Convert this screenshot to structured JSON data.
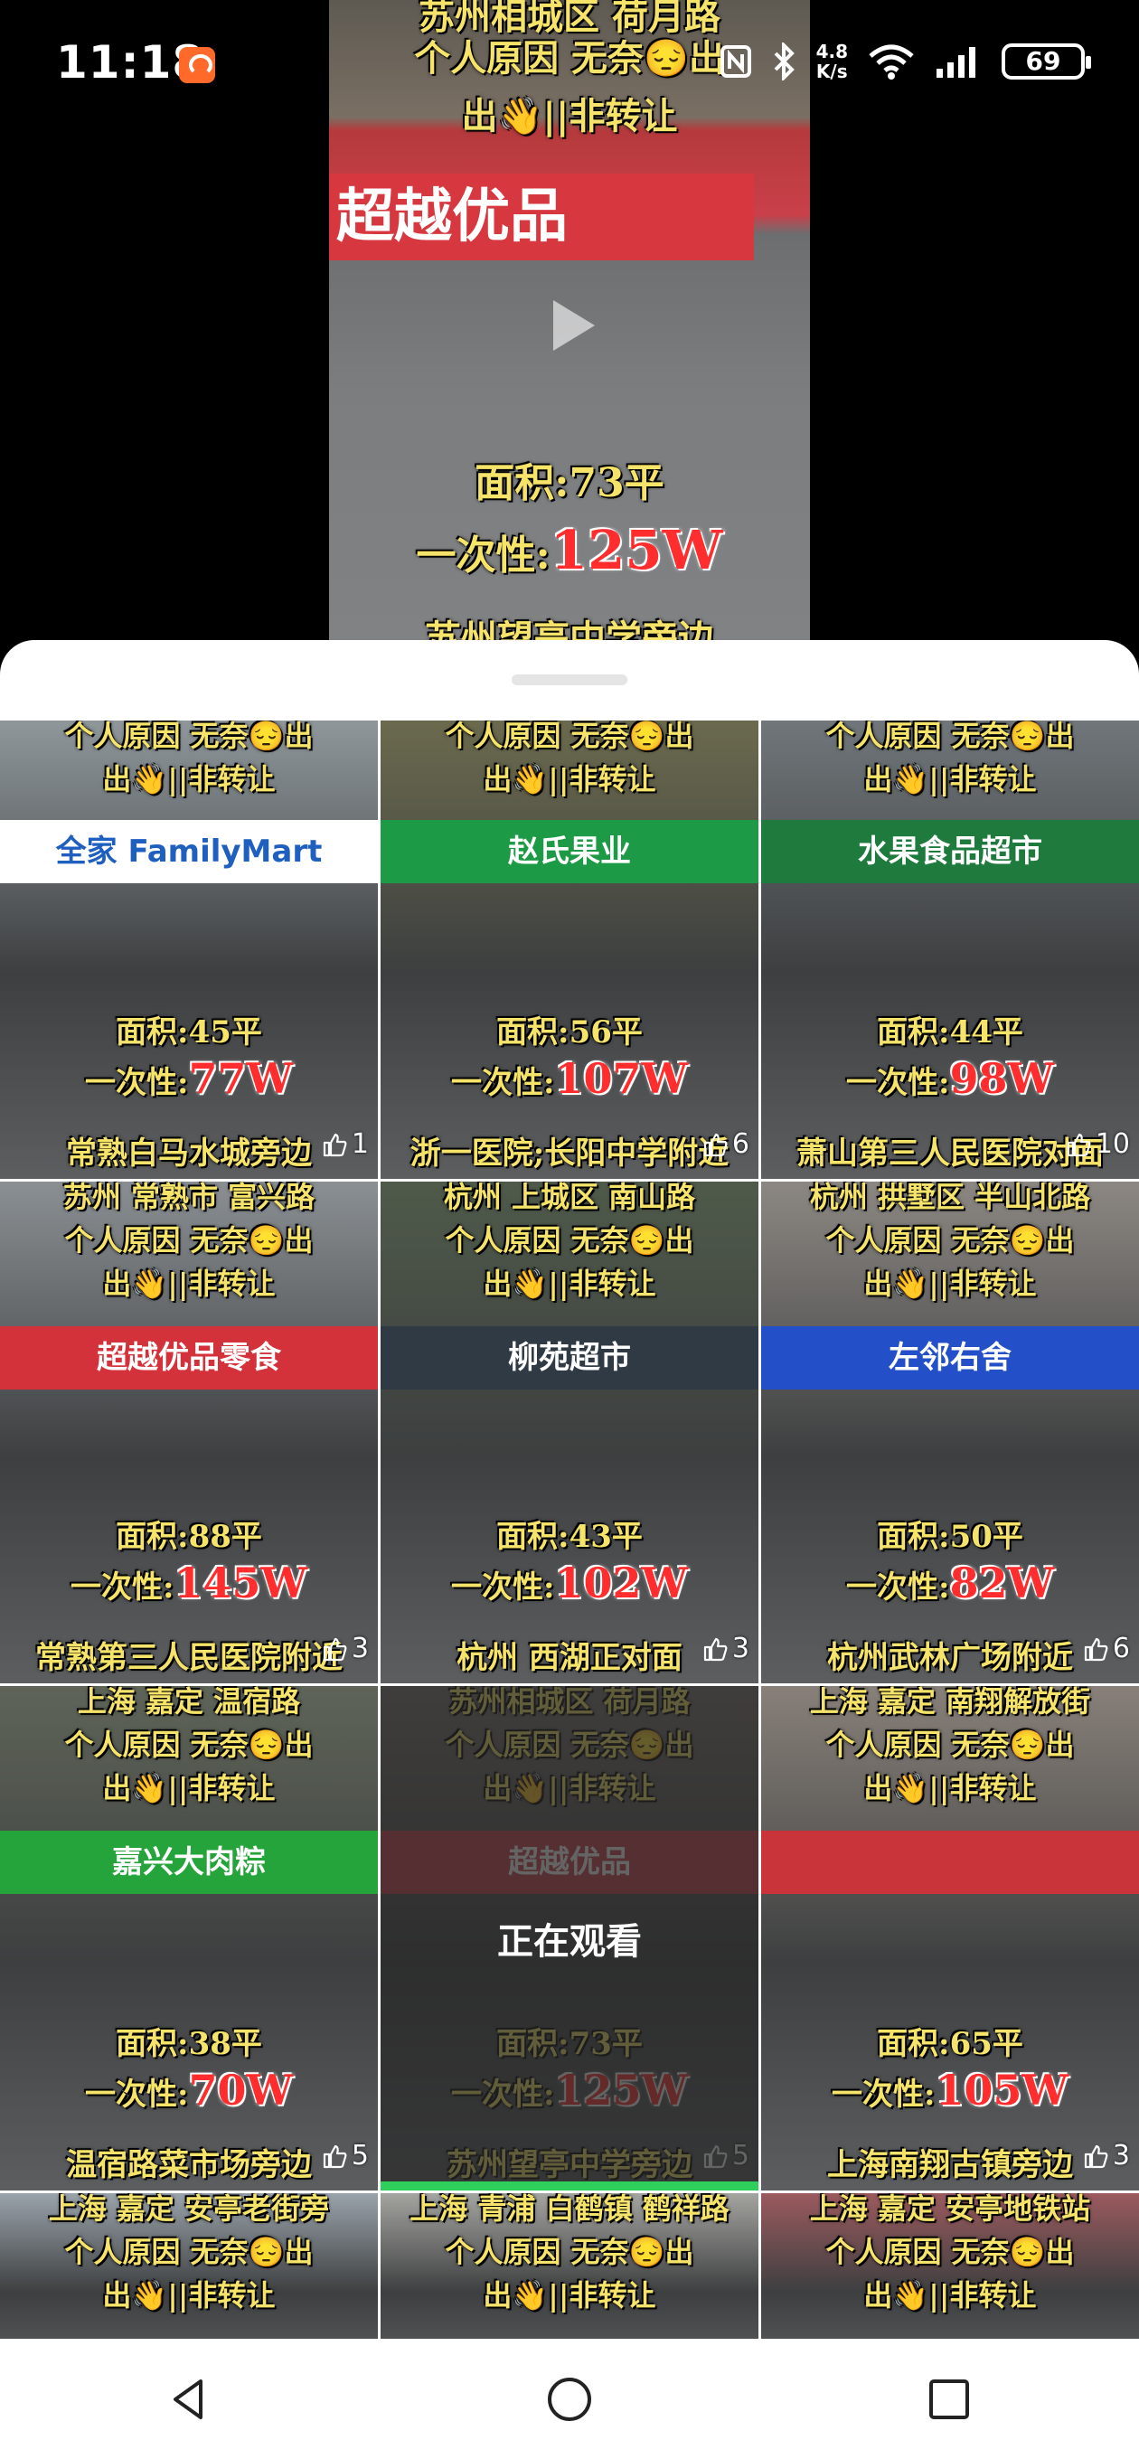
{
  "status_bar": {
    "time": "11:18",
    "network_speed_value": "4.8",
    "network_speed_unit": "K/s",
    "battery": "69",
    "icons": [
      "app-notification-icon",
      "nfc-icon",
      "bluetooth-icon",
      "wifi-icon",
      "signal-icon",
      "battery-icon"
    ]
  },
  "current_video": {
    "overlay_line1": "苏州相城区 荷月路",
    "overlay_line2": "个人原因 无奈😔出",
    "overlay_line3": "出👋||非转让",
    "store_sign": "超越优品",
    "area": "面积:73平",
    "price_prefix": "一次性:",
    "price": "125W",
    "location": "苏州望亭中学旁边"
  },
  "tiles": [
    {
      "line1": "个人原因 无奈😔出",
      "line2": "出👋||非转让",
      "sign": "全家 FamilyMart",
      "area": "面积:45平",
      "price": "77W",
      "location": "常熟白马水城旁边",
      "likes": "1",
      "bg": "#8f979b",
      "sign_color": "#ffffff",
      "sign_text": "#1f5fbf"
    },
    {
      "line1": "个人原因 无奈😔出",
      "line2": "出👋||非转让",
      "sign": "赵氏果业",
      "area": "面积:56平",
      "price": "107W",
      "location": "浙一医院;长阳中学附近",
      "likes": "6",
      "bg": "#6b6a4e",
      "sign_color": "#1c9a45",
      "sign_text": "#ffffff"
    },
    {
      "line1": "个人原因 无奈😔出",
      "line2": "出👋||非转让",
      "sign": "水果食品超市",
      "area": "面积:44平",
      "price": "98W",
      "location": "萧山第三人民医院对面",
      "likes": "10",
      "bg": "#70767a",
      "sign_color": "#1f7a3d",
      "sign_text": "#ffffff"
    },
    {
      "line1": "苏州 常熟市 富兴路",
      "line2": "个人原因 无奈😔出",
      "line3": "出👋||非转让",
      "sign": "超越优品零食",
      "area": "面积:88平",
      "price": "145W",
      "location": "常熟第三人民医院附近",
      "likes": "3",
      "bg": "#8a8f93",
      "sign_color": "#d4323a",
      "sign_text": "#ffffff"
    },
    {
      "line1": "杭州 上城区 南山路",
      "line2": "个人原因 无奈😔出",
      "line3": "出👋||非转让",
      "sign": "柳苑超市",
      "area": "面积:43平",
      "price": "102W",
      "location": "杭州 西湖正对面",
      "likes": "3",
      "bg": "#4f5a4a",
      "sign_color": "#2f3a44",
      "sign_text": "#ffffff"
    },
    {
      "line1": "杭州 拱墅区 半山北路",
      "line2": "个人原因 无奈😔出",
      "line3": "出👋||非转让",
      "sign": "左邻右舍",
      "area": "面积:50平",
      "price": "82W",
      "location": "杭州武林广场附近",
      "likes": "6",
      "bg": "#8c8782",
      "sign_color": "#2350c8",
      "sign_text": "#ffffff"
    },
    {
      "line1": "上海 嘉定 温宿路",
      "line2": "个人原因 无奈😔出",
      "line3": "出👋||非转让",
      "sign": "嘉兴大肉粽",
      "area": "面积:38平",
      "price": "70W",
      "location": "温宿路菜市场旁边",
      "likes": "5",
      "bg": "#5e6458",
      "sign_color": "#26a43c",
      "sign_text": "#ffffff"
    },
    {
      "line1": "苏州相城区 荷月路",
      "line2": "个人原因 无奈😔出",
      "line3": "出👋||非转让",
      "sign": "超越优品",
      "area": "面积:73平",
      "price": "125W",
      "location": "苏州望亭中学旁边",
      "likes": "5",
      "bg": "#7a7570",
      "sign_color": "#c9404a",
      "sign_text": "#ffffff",
      "watching": "正在观看"
    },
    {
      "line1": "上海 嘉定 南翔解放街",
      "line2": "个人原因 无奈😔出",
      "line3": "出👋||非转让",
      "sign": "",
      "area": "面积:65平",
      "price": "105W",
      "location": "上海南翔古镇旁边",
      "likes": "3",
      "bg": "#888079",
      "sign_color": "#c9333a",
      "sign_text": "#ffffff"
    },
    {
      "line1": "上海 嘉定 安亭老街旁",
      "line2": "个人原因 无奈😔出",
      "line3": "出👋||非转让",
      "bg": "#9aa3ab"
    },
    {
      "line1": "上海 青浦 白鹤镇 鹤祥路",
      "line2": "个人原因 无奈😔出",
      "line3": "出👋||非转让",
      "bg": "#a4a4a0"
    },
    {
      "line1": "上海 嘉定 安亭地铁站",
      "line2": "个人原因 无奈😔出",
      "line3": "出👋||非转让",
      "bg": "#9b5a5e"
    }
  ],
  "nav": {
    "icons": [
      "back-icon",
      "home-icon",
      "recents-icon"
    ]
  }
}
